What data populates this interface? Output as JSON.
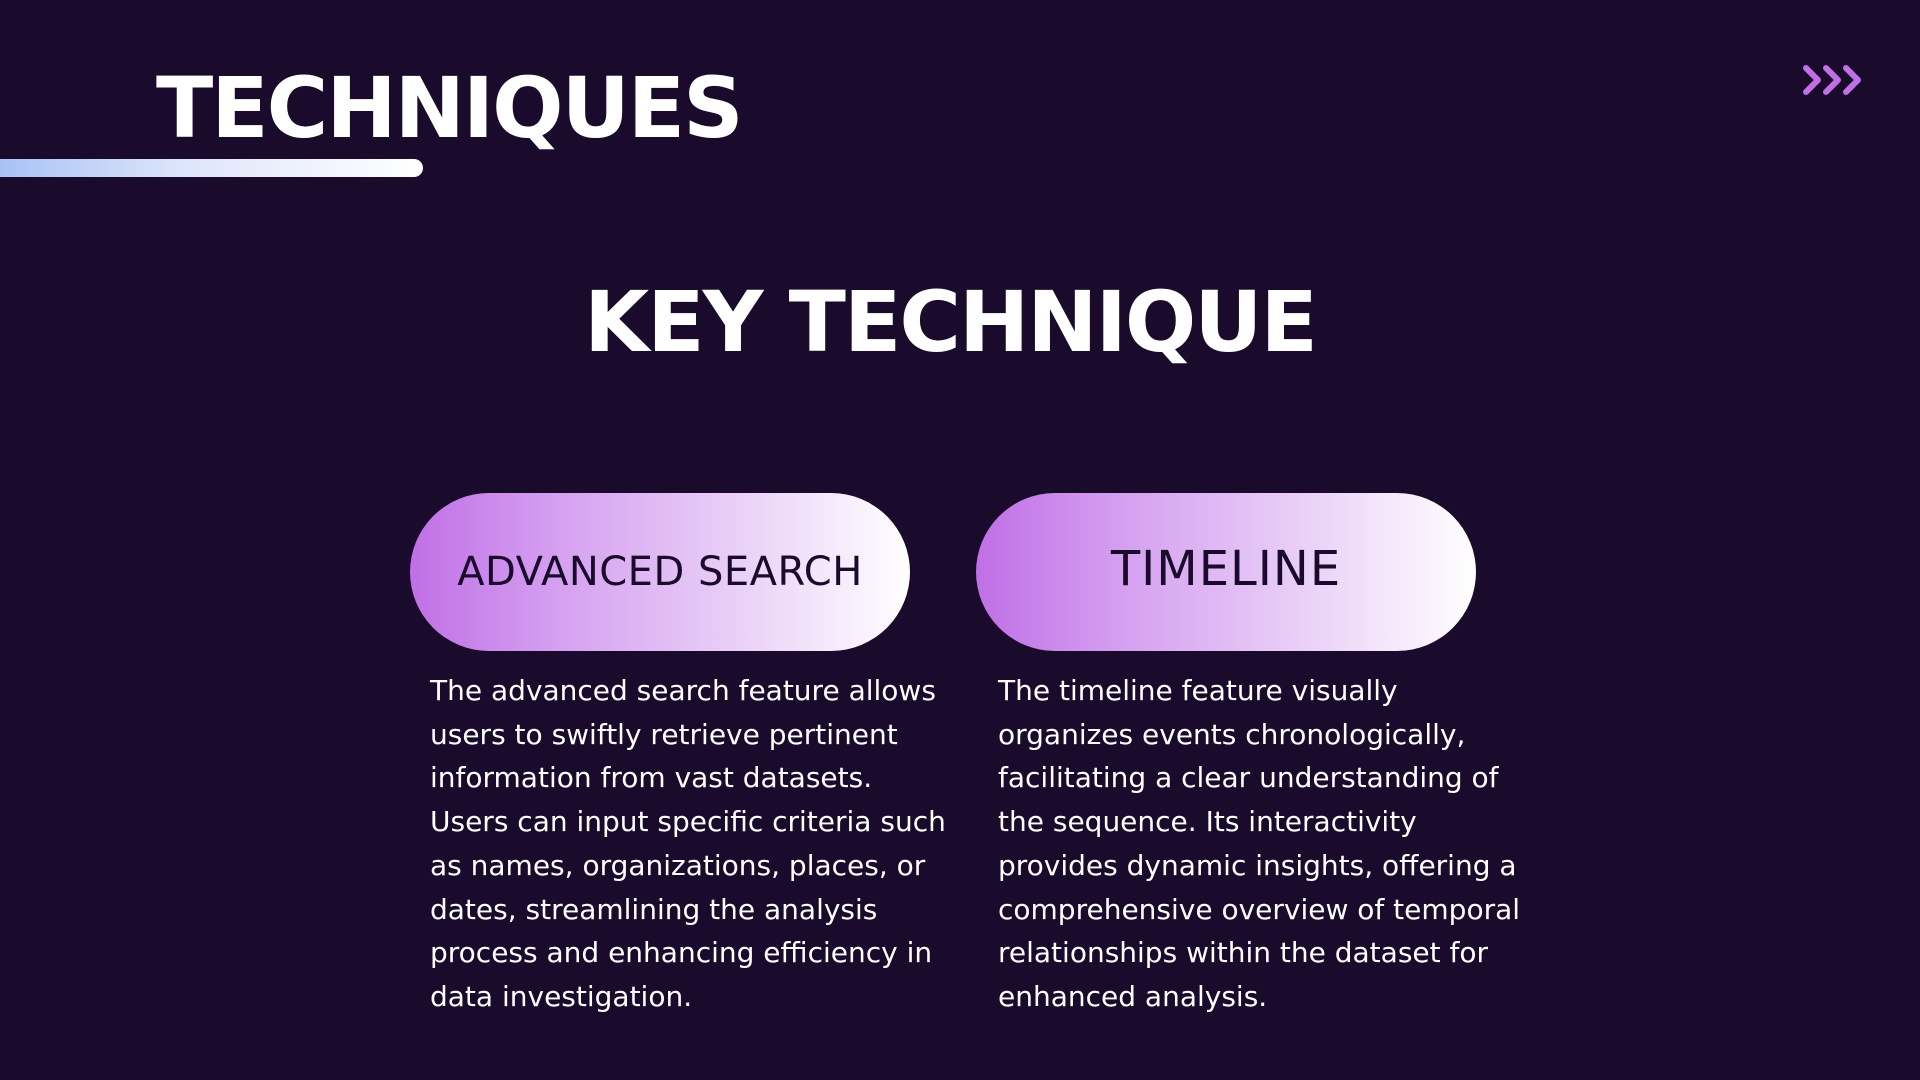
{
  "header": {
    "title": "TECHNIQUES",
    "nav_icon": "triple-chevron-right-icon",
    "accent_color": "#c06fe6",
    "underline_gradient": [
      "#a9c2f5",
      "#ffffff"
    ]
  },
  "main": {
    "title": "KEY TECHNIQUE",
    "cards": [
      {
        "label": "ADVANCED SEARCH",
        "description": "The advanced search feature allows users to swiftly retrieve pertinent information from vast datasets. Users can input specific criteria such as names, organizations, places, or dates, streamlining the analysis process and enhancing efficiency in data investigation."
      },
      {
        "label": "TIMELINE",
        "description": "The timeline feature visually organizes events chronologically, facilitating a clear understanding of the sequence. Its interactivity provides dynamic insights, offering a comprehensive overview of temporal relationships within the dataset for enhanced analysis."
      }
    ]
  },
  "colors": {
    "background": "#1a0a2b",
    "text": "#ffffff",
    "pill_gradient": [
      "#c06fe6",
      "#ffffff"
    ],
    "pill_text": "#1a0a2b"
  }
}
